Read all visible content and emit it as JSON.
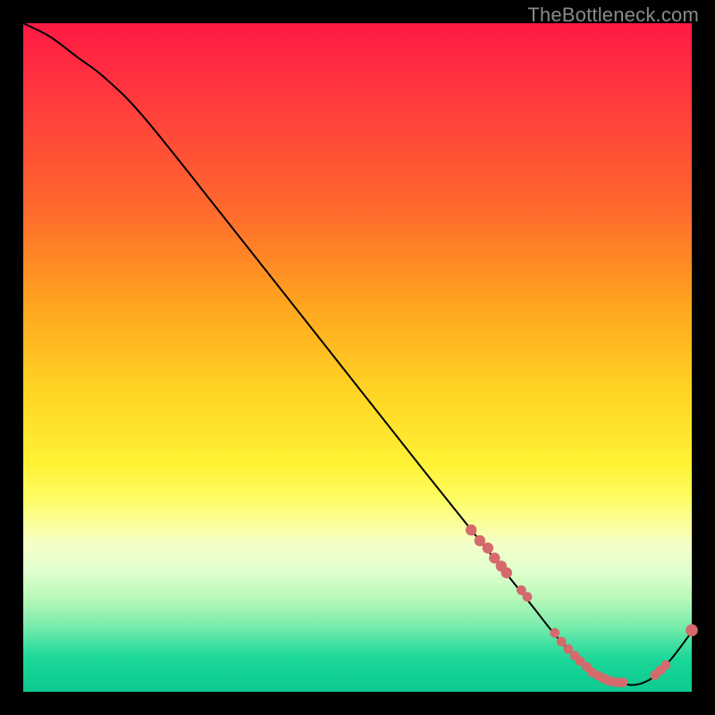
{
  "watermark": "TheBottleneck.com",
  "chart_data": {
    "type": "line",
    "title": "",
    "xlabel": "",
    "ylabel": "",
    "xlim": [
      0,
      100
    ],
    "ylim": [
      0,
      100
    ],
    "grid": false,
    "curve": {
      "x": [
        0,
        4,
        8,
        12,
        18,
        30,
        45,
        60,
        68,
        72,
        76,
        80,
        84,
        88,
        91,
        94,
        97,
        100
      ],
      "y": [
        100,
        98,
        95,
        92,
        86,
        71,
        52,
        33,
        23,
        18,
        13,
        8,
        4,
        2,
        1,
        2,
        5,
        9
      ]
    },
    "highlight_points": {
      "x": [
        67.0,
        68.3,
        69.5,
        70.5,
        71.5,
        72.3,
        74.5,
        75.4,
        79.5,
        80.5,
        81.5,
        82.5,
        83.3,
        84.3,
        85.1,
        86.0,
        86.8,
        87.5,
        88.2,
        89.0,
        89.7,
        94.5,
        95.3,
        96.1,
        100.0
      ],
      "y": [
        24.2,
        22.6,
        21.5,
        20.0,
        18.8,
        17.8,
        15.2,
        14.2,
        8.8,
        7.5,
        6.4,
        5.4,
        4.6,
        3.7,
        2.9,
        2.4,
        2.0,
        1.7,
        1.5,
        1.4,
        1.4,
        2.5,
        3.2,
        4.0,
        9.2
      ],
      "r": [
        6.2,
        6.2,
        6.2,
        6.2,
        6.2,
        6.2,
        5.4,
        5.4,
        5.4,
        5.4,
        5.4,
        5.4,
        5.4,
        5.4,
        5.4,
        5.4,
        5.4,
        5.4,
        5.4,
        5.4,
        5.4,
        5.4,
        5.4,
        5.4,
        6.8
      ]
    }
  }
}
